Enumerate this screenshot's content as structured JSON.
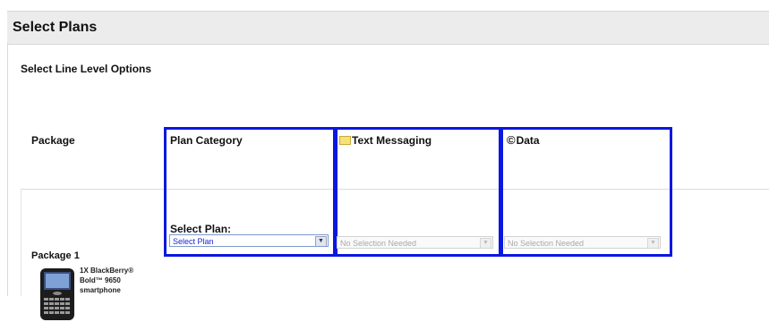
{
  "header": {
    "title": "Select Plans"
  },
  "section": {
    "title": "Select Line Level Options"
  },
  "columns": {
    "package": "Package",
    "plan_category": "Plan Category",
    "text_messaging": "Text Messaging",
    "data": "Data"
  },
  "package_row": {
    "name": "Package 1",
    "device_line1": "1X  BlackBerry®",
    "device_line2": "Bold™ 9650",
    "device_line3": "smartphone",
    "select_plan_label": "Select Plan:",
    "plan_select_value": "Select Plan",
    "text_select_value": "No Selection Needed",
    "data_select_value": "No Selection Needed"
  },
  "icons": {
    "text_messaging": "folder-icon",
    "data": "copyright-icon"
  },
  "colors": {
    "highlight_border": "#0a17e0",
    "select_text": "#1a23d8"
  }
}
